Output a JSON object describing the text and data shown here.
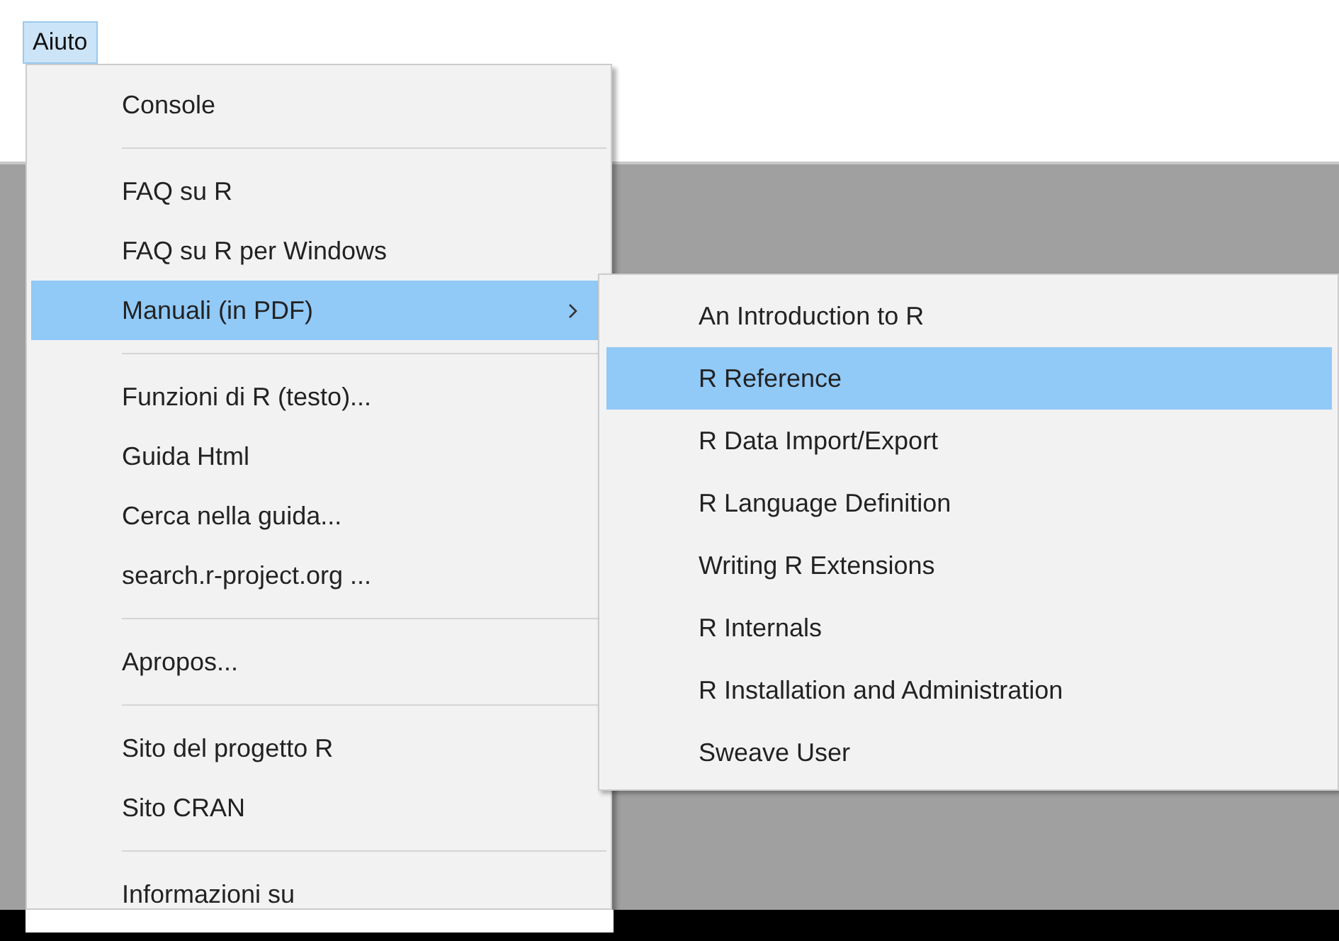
{
  "menubar": [
    {
      "label": "Aiuto",
      "selected": true
    }
  ],
  "menu": {
    "items": [
      {
        "kind": "item",
        "label": "Console",
        "selected": false,
        "has_submenu": false
      },
      {
        "kind": "separator"
      },
      {
        "kind": "item",
        "label": "FAQ su R",
        "selected": false,
        "has_submenu": false
      },
      {
        "kind": "item",
        "label": "FAQ su R per Windows",
        "selected": false,
        "has_submenu": false
      },
      {
        "kind": "item",
        "label": "Manuali (in PDF)",
        "selected": true,
        "has_submenu": true
      },
      {
        "kind": "separator"
      },
      {
        "kind": "item",
        "label": "Funzioni di R (testo)...",
        "selected": false,
        "has_submenu": false
      },
      {
        "kind": "item",
        "label": "Guida Html",
        "selected": false,
        "has_submenu": false
      },
      {
        "kind": "item",
        "label": "Cerca nella guida...",
        "selected": false,
        "has_submenu": false
      },
      {
        "kind": "item",
        "label": "search.r-project.org ...",
        "selected": false,
        "has_submenu": false
      },
      {
        "kind": "separator"
      },
      {
        "kind": "item",
        "label": "Apropos...",
        "selected": false,
        "has_submenu": false
      },
      {
        "kind": "separator"
      },
      {
        "kind": "item",
        "label": "Sito del progetto R",
        "selected": false,
        "has_submenu": false
      },
      {
        "kind": "item",
        "label": "Sito CRAN",
        "selected": false,
        "has_submenu": false
      },
      {
        "kind": "separator"
      },
      {
        "kind": "item",
        "label": "Informazioni su",
        "selected": false,
        "has_submenu": false
      }
    ]
  },
  "submenu": {
    "items": [
      {
        "label": "An Introduction to R",
        "selected": false
      },
      {
        "label": "R Reference",
        "selected": true
      },
      {
        "label": "R Data Import/Export",
        "selected": false
      },
      {
        "label": "R Language Definition",
        "selected": false
      },
      {
        "label": "Writing R Extensions",
        "selected": false
      },
      {
        "label": "R Internals",
        "selected": false
      },
      {
        "label": "R Installation and Administration",
        "selected": false
      },
      {
        "label": "Sweave User",
        "selected": false
      }
    ]
  }
}
